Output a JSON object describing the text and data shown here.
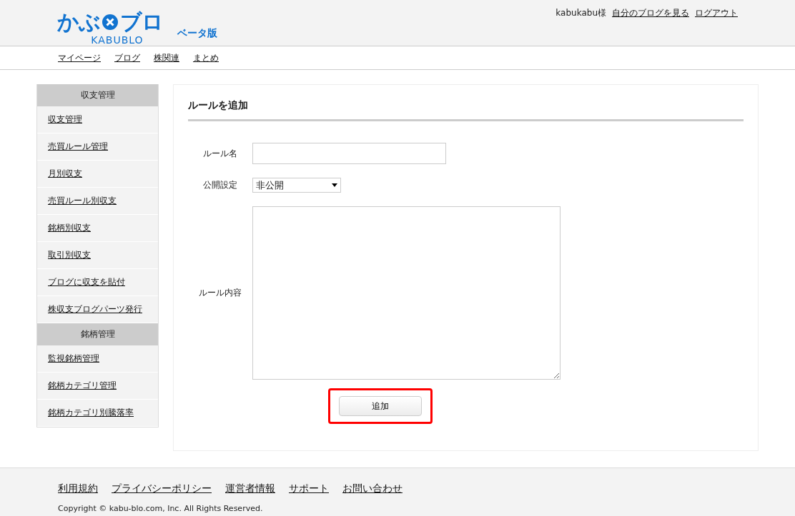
{
  "logo": {
    "left": "かぶ",
    "right": "ブロ",
    "sub": "KABUBLO",
    "badge": "ベータ版"
  },
  "user_menu": {
    "user": "kabukabu様",
    "links": [
      "自分のブログを見る",
      "ログアウト"
    ]
  },
  "nav": [
    "マイページ",
    "ブログ",
    "株関連",
    "まとめ"
  ],
  "sidebar": [
    {
      "heading": "収支管理",
      "items": [
        "収支管理",
        "売買ルール管理",
        "月別収支",
        "売買ルール別収支",
        "銘柄別収支",
        "取引別収支",
        "ブログに収支を貼付",
        "株収支ブログパーツ発行"
      ]
    },
    {
      "heading": "銘柄管理",
      "items": [
        "監視銘柄管理",
        "銘柄カテゴリ管理",
        "銘柄カテゴリ別騰落率"
      ]
    }
  ],
  "form": {
    "title": "ルールを追加",
    "fields": [
      {
        "kind": "text",
        "label": "ルール名"
      },
      {
        "kind": "select",
        "label": "公開設定",
        "value": "非公開"
      },
      {
        "kind": "textarea",
        "label": "ルール内容"
      }
    ],
    "submit": {
      "label": "追加",
      "highlighted": true
    }
  },
  "footer": {
    "links": [
      "利用規約",
      "プライバシーポリシー",
      "運営者情報",
      "サポート",
      "お問い合わせ"
    ],
    "copyright": "Copyright © kabu-blo.com, Inc. All Rights Reserved."
  }
}
